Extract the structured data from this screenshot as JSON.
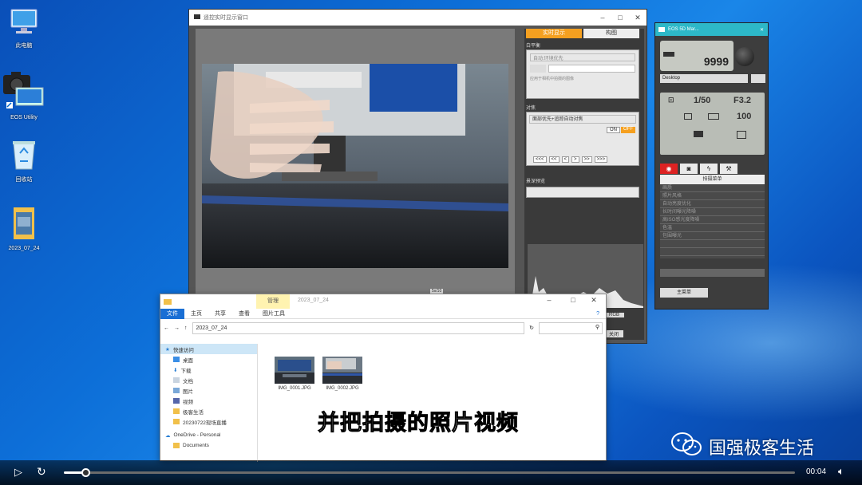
{
  "desktop": {
    "icons": [
      {
        "label": "此电脑"
      },
      {
        "label": "EOS Utility"
      },
      {
        "label": "回收站"
      },
      {
        "label": "2023_07_24"
      }
    ]
  },
  "live_window": {
    "title": "遥控实时显示窗口",
    "tabs": [
      "实时显示",
      "构图"
    ],
    "section_white_balance": "白平衡",
    "wb_value": "自动:环境优先",
    "wb_checkbox": "应用于相机中拍摄的图像",
    "section_focus": "对焦",
    "focus_mode": "面部优先+追踪自动对焦",
    "on_label": "ON",
    "off_label": "OFF",
    "nav_buttons": [
      "<<<",
      "<<",
      "<",
      ">",
      ">>",
      ">>>"
    ],
    "section_depth": "景深预览",
    "zoom_label": "5x/10",
    "rgb_label": "RGB",
    "close_label": "关闭"
  },
  "eos_panel": {
    "title": "EOS 5D Mar...",
    "shots_remaining": "9999",
    "destination": "Desktop",
    "shutter": "1/50",
    "aperture": "F3.2",
    "iso": "100",
    "tabs": [
      "camera",
      "camera-settings",
      "flash",
      "tools"
    ],
    "menu_title": "拍摄菜单",
    "menu_rows": [
      "画质",
      "照片风格",
      "自动亮度优化",
      "长时间曝光降噪",
      "高ISO感光度降噪",
      "色温",
      "包围曝光",
      "",
      ""
    ],
    "footer_btn": "主菜单"
  },
  "explorer": {
    "path_title": "2023_07_24",
    "manage_tab": "管理",
    "ribbon": [
      "文件",
      "主页",
      "共享",
      "查看",
      "图片工具"
    ],
    "address": "2023_07_24",
    "nav_items": [
      "快速访问",
      "桌面",
      "下载",
      "文档",
      "图片",
      "视频",
      "极客生活",
      "20230722现场直播",
      "OneDrive - Personal",
      "Documents"
    ],
    "files": [
      {
        "name": "IMG_0001.JPG"
      },
      {
        "name": "IMG_0002.JPG"
      }
    ]
  },
  "subtitle": "并把拍摄的照片视频",
  "watermark": "国强极客生活",
  "player": {
    "time": "00:04",
    "progress": 0.03
  }
}
